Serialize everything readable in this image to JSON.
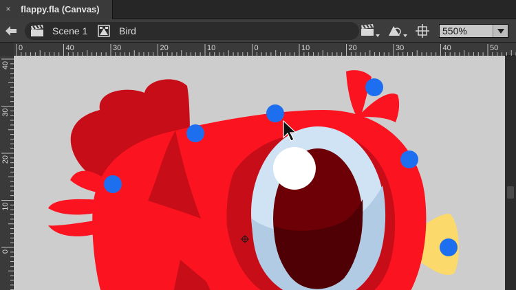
{
  "tab": {
    "close_glyph": "×",
    "title": "flappy.fla (Canvas)"
  },
  "editbar": {
    "back_icon": "arrow-left-icon",
    "scene_label": "Scene 1",
    "symbol_label": "Bird",
    "zoom_value": "550%"
  },
  "rulers": {
    "horizontal_labels": [
      "0",
      "40",
      "30",
      "20",
      "10",
      "0",
      "10",
      "20",
      "30",
      "40",
      "50"
    ],
    "vertical_labels": [
      "40",
      "30",
      "20",
      "10",
      "0"
    ]
  },
  "colors": {
    "canvas": "#cdcdcd",
    "bird_body": "#fc1320",
    "bird_dark": "#c70e18",
    "eye_rim": "#d0e3f4",
    "pupil": "#6c0006",
    "beak": "#fbd96a",
    "control_point": "#1e6ff0"
  },
  "icons": {
    "scene": "clapperboard-icon",
    "symbol": "movie-clip-symbol-icon",
    "edit_scene": "edit-scene-icon",
    "edit_symbol": "edit-symbol-icon",
    "center_stage": "center-stage-crosshair-icon",
    "zoom_dropdown": "chevron-down-icon",
    "cursor": "mouse-pointer-icon",
    "registration": "registration-point-icon"
  }
}
